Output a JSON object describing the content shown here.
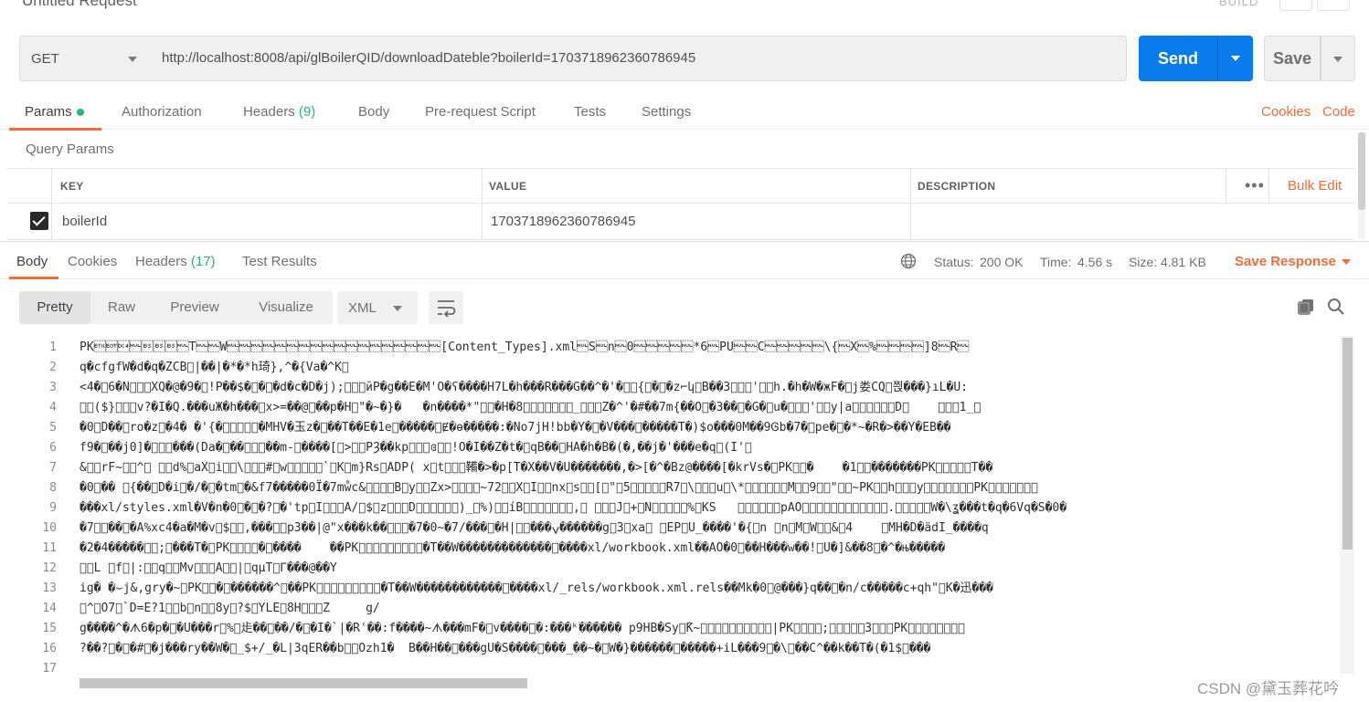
{
  "request": {
    "title": "Untitled Request",
    "build_label": "BUILD",
    "method": "GET",
    "url": "http://localhost:8008/api/glBoilerQID/downloadDateble?boilerId=1703718962360786945",
    "send_label": "Send",
    "save_label": "Save"
  },
  "request_tabs": {
    "params": "Params",
    "authorization": "Authorization",
    "headers": "Headers",
    "headers_count": "(9)",
    "body": "Body",
    "pre_request": "Pre-request Script",
    "tests": "Tests",
    "settings": "Settings",
    "cookies": "Cookies",
    "code": "Code"
  },
  "query_params": {
    "title": "Query Params",
    "columns": {
      "key": "KEY",
      "value": "VALUE",
      "description": "DESCRIPTION"
    },
    "more": "•••",
    "bulk_edit": "Bulk Edit",
    "rows": [
      {
        "key": "boilerId",
        "value": "1703718962360786945",
        "description": "",
        "checked": true
      }
    ]
  },
  "response": {
    "tabs": {
      "body": "Body",
      "cookies": "Cookies",
      "headers": "Headers",
      "headers_count": "(17)",
      "test_results": "Test Results"
    },
    "status_label": "Status:",
    "status_value": "200 OK",
    "time_label": "Time:",
    "time_value": "4.56 s",
    "size_label": "Size:",
    "size_value": "4.81 KB",
    "save_response": "Save Response",
    "views": {
      "pretty": "Pretty",
      "raw": "Raw",
      "preview": "Preview",
      "visualize": "Visualize"
    },
    "format": "XML",
    "lines": [
      {
        "n": "1",
        "text": "PK\u0003\u0004\u0014\u0000\b\b\b\u0000T\u0000\u0000W\u0000\u0000\u0000\u0000\u0000\u0000\u0000\u0000\u0000\u0000\u0000\u0000\u0000\u0000\u0000\u0000\u0000\u0000[Content_Types].xml\u0000S\u0000n\u00000\u0000\u0000\u0000\u0000\u0000*6\u0000PU\u0000\u0000C\u0000\u0000\u0000\u0000\u0000\\{\u0000X\u0000%\u0000\u0000\u0000\u0000]8\u0000R\u0000"
      },
      {
        "n": "2",
        "text": "q�cfgfW�d�q�ZCB\u0000|��|�*�*h琦},^�{Va�^K\u0000"
      },
      {
        "n": "3",
        "text": "<4�\u00006�N\u0000\u0000\u0000XQ�@�9�\u0000!P��$�\u0000�\u0000�d�c�D�j);\u0000\u0000\u0000йP�g��E�M'O�ʕ����H7L�h���R���G��^�'�\u0000\u0000{\u0000�\u0000�z⌐կ\u0000B��3\u0000\u0000\u0000'\u0000\u0000h.�h�W�жF�\u0000j娄CQ\u0000쯵���}ıL�U:"
      },
      {
        "n": "4",
        "text": "\u0000\u0000($}\u0000\u0000\u0000v?�I�Q.���uЖ�h���\u0000x>=��@\u0000��p�H\u0000\"�~�}�   �n����*\"\u0000\u0000�H�8\u0000\u0000\u0000\u0000\u0000\u0000\u0000_\u0000\u0000\u0000Z�^'�#��7m{��O\u0000�3��\u0000�G�\u0000u�⟍\u0000\u0000'\u0000\u0000y|a\u0000\u0000\u0000\u0000\u0000\u0000D\u0000    \u0000\u0000\u00001_\u0000"
      },
      {
        "n": "5",
        "text": "�0\u0000D��\u0000ro�z\u0000�4� �'{�\u0000\u0000\u0000\u0000\u0000�MHV�玉z�\u0000��T��E�1e\u0000�����\u0000Ɇ�ɵ�����:�No7jH!bb�Y�\u0000�V���\u0000�����T�)$o���0M��9Ꮆb�7�\u0000pe�\u0000�*~�R�>��Y�EB��"
      },
      {
        "n": "6",
        "text": "f9�\u0000��j0]�\u0000\u0000\u0000���(Da�\u0000��\u0000\u0000\u0000��m-\u0000����[\u0000>\u0000\u0000PȜ��kp\u0000\u0000\u0000ɞ\u0000\u0000!O�I��Z�t�\u0000qB��\u0000HA�h�B�(�,��j�'���e�q\u0000(I'\u0000"
      },
      {
        "n": "7",
        "text": "&\u0000\u0000rF~\u0000\u0000^\u0000 \u0000\u0000d%\u0000aX\u0000i\u0000\u0000\\\u0000\u0000\u0000#\u0000w\u0000\u0000\u0000\u0000\u0000`\u0000K\u0000m}Rs\u0000ADP( x\u0000t\u0000\u0000\u0000鞴�>�p[T�X��V�U�������,�>[�^�Bz@����[�krVs�\u0000PK\u0000\u0000�    �1\u0000\u0000�������PK\u0000\u0000\u0000\u0000\u0000T��"
      },
      {
        "n": "8",
        "text": "�0\u0000�� \u0000{��\u0000D�i\u0000�/�\u0000�tm\u0000�&f7�����0Ï�7mẘc&\u0000\u0000\u0000\u0000B\u0000y\u0000\u0000Zx>\u0000\u0000\u0000\u0000~72\u0000\u0000X\u0000I\u0000\u0000nx\u0000s\u0000\u0000[\u0000\"\u00005\u0000\u0000\u0000\u0000\u0000R7\u0000\\\u0000\u0000\u0000u\u0000\\*\u0000\u0000\u0000\u0000\u0000\u0000M\u0000\u00009\u0000\u0000\"\u0000\u0000~PK\u0000\u0000h\u0000\u0000\u0000y\u0000\u0000\u0000\u0000\u0000\u0000\u0000PK\u0000\u0000\u0000\u0000\u0000\u0000\u0000"
      },
      {
        "n": "9",
        "text": "���xl/styles.xml�V�n�0\u0000�\u0000�?\u0000�'tp\u0000I\u0000\u0000\u0000A/\u0000$\u0000z\u0000\u0000\u0000D\u0000\u0000\u0000\u0000\u0000\u0000)_\u0000%)\u0000\u0000íB\u0000\u0000\u0000\u0000\u0000\u0000\u0000,\u0000 \u0000\u0000\u0000J\u0000+\u0000N\u0000\u0000\u0000\u0000\u0000%\u0000KS   \u0000\u0000\u0000\u0000\u0000\u0000pAO\u0000\u0000\u0000\u0000\u0000\u0000\u0000\u0000\u0000\u0000\u0000\u0000.\u0000\u0000\u0000\u0000\u0000W�\\ʓ���t�q�6Vq�S�0�"
      },
      {
        "n": "10",
        "text": "�7\u0000\u0000��\u0000�A%xc4�a�M�v\u0000$\u0000\u0000,���\u0000\u0000p3��|@\"x���k��\u0000\u0000\u0000�7�0~�7/���\u0000�H|\u0000\u0000���ݍ������g\u00003\u0000xa\u0000 \u0000EP\u0000U_����'�{\u0000n \u0000n\u0000M\u0000W\u0000\u0000&\u00004    \u0000MH�D�ädI_����q"
      },
      {
        "n": "11",
        "text": "�2�4�����\u0000\u0000;\u0000���T�\u0000PK\u0000\u0000\u0000\u0000�\u0000����    ��PK\u0000\u0000\u0000\u0000\u0000\u0000\u0000\u0000\u0000�T��W�������������\u0000����xl/workbook.xml��AO�0\u0000��H���w��!\u0000U�]&��8\u0000�^�њ�����"
      },
      {
        "n": "12",
        "text": "\u0000\u0000L \u0000f\u0000|:\u0000\u0000q\u0000\u0000Mv\u0000\u0000\u0000A\u0000\u0000|\u0000qμT\u0000Γ���@��Y"
      },
      {
        "n": "13",
        "text": "ig� �⌣j&,gry�~\u0000PK\u0000\u0000�\u0000������^\u0000��PK\u0000\u0000\u0000\u0000\u0000\u0000\u0000\u0000\u0000�T��W������������\u0000����xl/_rels/workbook.xml.rels��Mk�0\u0000@���}q��\u0000�n/c�����c+qh\"\u0000K�迅���"
      },
      {
        "n": "14",
        "text": "\u0000^\u0000O7\u0000`D=E?1\u0000\u0000b\u0000n\u0000\u00008y\u0000?$\u0000YLE\u00008H\u0000\u0000\u0000Z     g/"
      },
      {
        "n": "15",
        "text": "g����^�ᗑ6�p�\u0000�U���r\u0000%\u0000歨��\u0000��/�\u0000�I�`|�Rʿ��:f����~ᗑ���mF�\u0000v����\u0000�:���ᵏ������ p9HB�Syஞ̑K~\u0000\u0000\u0000\u0000\u0000\u0000\u0000\u0000\u0000\u0000|PK\u0000\u0000\u0000\u0000;\u0000\u0000\u0000\u0000\u00003\u0000\u0000\u0000PK\u0000\u0000\u0000\u0000\u0000\u0000\u0000\u0000"
      },
      {
        "n": "16",
        "text": "?��?\u0000�\u0000�#\u0000�j���ry��W�\u0000_$+/_�L|3qER��b\u0000\u0000Oᴢh1�  B��H��\u0000���gU�S����\u0000���_��~�\u0000W�}������\u0000�����+iL���9\u0000�\\\u0000��C^��k��T�(�1$\u0000���"
      },
      {
        "n": "17",
        "text": ""
      }
    ]
  },
  "watermark": "CSDN @黛玉葬花吟",
  "colors": {
    "accent": "#f26b3a",
    "send": "#097bed",
    "ok_green": "#26b47f"
  }
}
